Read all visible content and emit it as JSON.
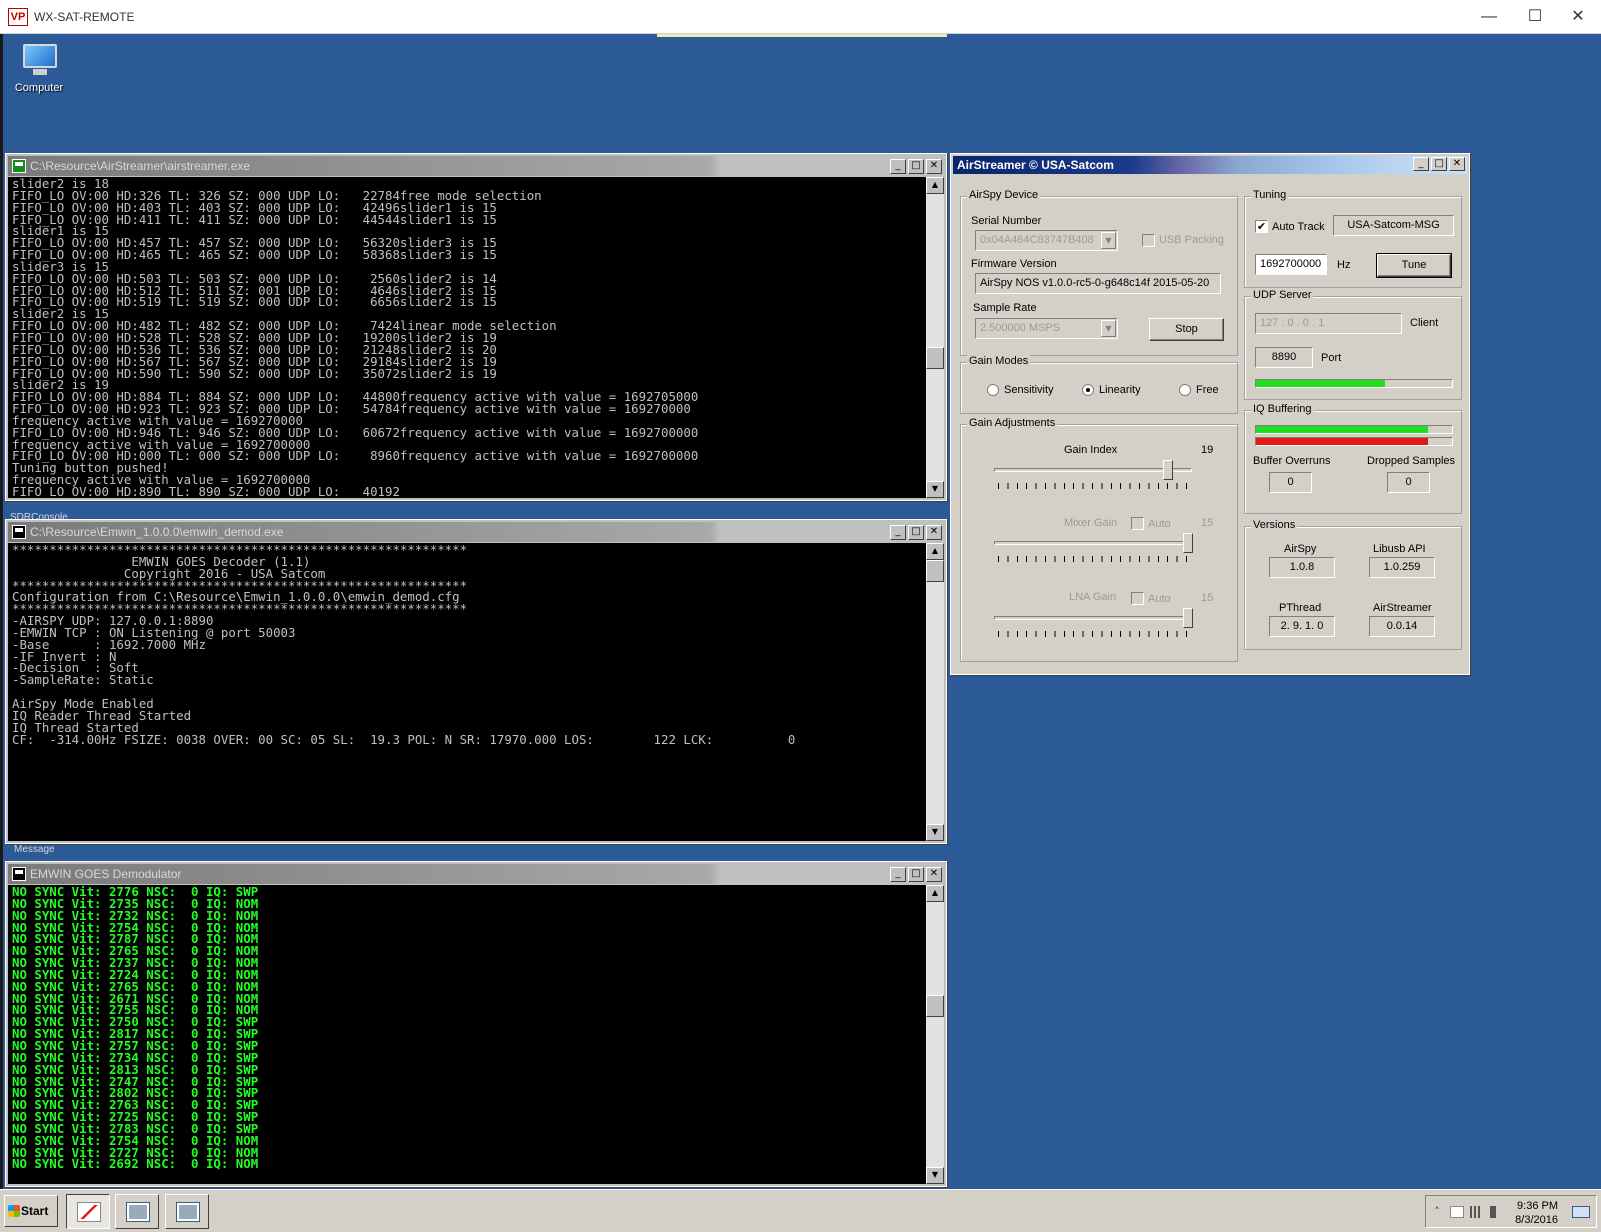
{
  "remote": {
    "title": "WX-SAT-REMOTE",
    "logo_text": "VP",
    "minimize": "—",
    "maximize": "☐",
    "close": "✕"
  },
  "desktop": {
    "computer_label": "Computer",
    "sdr_ghost": "SDRConsole",
    "message_ghost": "Message"
  },
  "airstreamer_console": {
    "title": "C:\\Resource\\AirStreamer\\airstreamer.exe",
    "lines": [
      "slider2 is 18",
      "FIFO_LO OV:00 HD:326 TL: 326 SZ: 000 UDP LO:   22784free mode selection",
      "FIFO_LO OV:00 HD:403 TL: 403 SZ: 000 UDP LO:   42496slider1 is 15",
      "FIFO_LO OV:00 HD:411 TL: 411 SZ: 000 UDP LO:   44544slider1 is 15",
      "slider1 is 15",
      "FIFO_LO OV:00 HD:457 TL: 457 SZ: 000 UDP LO:   56320slider3 is 15",
      "FIFO_LO OV:00 HD:465 TL: 465 SZ: 000 UDP LO:   58368slider3 is 15",
      "slider3 is 15",
      "FIFO_LO OV:00 HD:503 TL: 503 SZ: 000 UDP LO:    2560slider2 is 14",
      "FIFO_LO OV:00 HD:512 TL: 511 SZ: 001 UDP LO:    4646slider2 is 15",
      "FIFO_LO OV:00 HD:519 TL: 519 SZ: 000 UDP LO:    6656slider2 is 15",
      "slider2 is 15",
      "FIFO_LO OV:00 HD:482 TL: 482 SZ: 000 UDP LO:    7424linear mode selection",
      "FIFO_LO OV:00 HD:528 TL: 528 SZ: 000 UDP LO:   19200slider2 is 19",
      "FIFO_LO OV:00 HD:536 TL: 536 SZ: 000 UDP LO:   21248slider2 is 20",
      "FIFO_LO OV:00 HD:567 TL: 567 SZ: 000 UDP LO:   29184slider2 is 19",
      "FIFO_LO OV:00 HD:590 TL: 590 SZ: 000 UDP LO:   35072slider2 is 19",
      "slider2 is 19",
      "FIFO_LO OV:00 HD:884 TL: 884 SZ: 000 UDP LO:   44800frequency active with value = 1692705000",
      "FIFO_LO OV:00 HD:923 TL: 923 SZ: 000 UDP LO:   54784frequency active with value = 169270000",
      "frequency active with value = 169270000",
      "FIFO_LO OV:00 HD:946 TL: 946 SZ: 000 UDP LO:   60672frequency active with value = 1692700000",
      "frequency active with value = 1692700000",
      "FIFO_LO OV:00 HD:000 TL: 000 SZ: 000 UDP LO:    8960frequency active with value = 1692700000",
      "Tuning button pushed!",
      "frequency active with value = 1692700000",
      "FIFO_LO OV:00 HD:890 TL: 890 SZ: 000 UDP LO:   40192"
    ]
  },
  "emwin_console": {
    "title": "C:\\Resource\\Emwin_1.0.0.0\\emwin_demod.exe",
    "lines": [
      "*************************************************************",
      "                EMWIN GOES Decoder (1.1)",
      "               Copyright 2016 - USA Satcom",
      "*************************************************************",
      "Configuration from C:\\Resource\\Emwin_1.0.0.0\\emwin_demod.cfg",
      "*************************************************************",
      "-AIRSPY UDP: 127.0.0.1:8890",
      "-EMWIN TCP : ON Listening @ port 50003",
      "-Base      : 1692.7000 MHz",
      "-IF Invert : N",
      "-Decision  : Soft",
      "-SampleRate: Static",
      "",
      "AirSpy Mode Enabled",
      "IQ Reader Thread Started",
      "IQ Thread Started",
      "CF:  -314.00Hz FSIZE: 0038 OVER: 00 SC: 05 SL:  19.3 POL: N SR: 17970.000 LOS:        122 LCK:          0"
    ]
  },
  "demod_console": {
    "title": "EMWIN GOES Demodulator",
    "lines": [
      "NO SYNC Vit: 2776 NSC:  0 IQ: SWP",
      "NO SYNC Vit: 2735 NSC:  0 IQ: NOM",
      "NO SYNC Vit: 2732 NSC:  0 IQ: NOM",
      "NO SYNC Vit: 2754 NSC:  0 IQ: NOM",
      "NO SYNC Vit: 2787 NSC:  0 IQ: NOM",
      "NO SYNC Vit: 2765 NSC:  0 IQ: NOM",
      "NO SYNC Vit: 2737 NSC:  0 IQ: NOM",
      "NO SYNC Vit: 2724 NSC:  0 IQ: NOM",
      "NO SYNC Vit: 2765 NSC:  0 IQ: NOM",
      "NO SYNC Vit: 2671 NSC:  0 IQ: NOM",
      "NO SYNC Vit: 2755 NSC:  0 IQ: NOM",
      "NO SYNC Vit: 2750 NSC:  0 IQ: SWP",
      "NO SYNC Vit: 2817 NSC:  0 IQ: SWP",
      "NO SYNC Vit: 2757 NSC:  0 IQ: SWP",
      "NO SYNC Vit: 2734 NSC:  0 IQ: SWP",
      "NO SYNC Vit: 2813 NSC:  0 IQ: SWP",
      "NO SYNC Vit: 2747 NSC:  0 IQ: SWP",
      "NO SYNC Vit: 2802 NSC:  0 IQ: SWP",
      "NO SYNC Vit: 2763 NSC:  0 IQ: SWP",
      "NO SYNC Vit: 2725 NSC:  0 IQ: SWP",
      "NO SYNC Vit: 2783 NSC:  0 IQ: SWP",
      "NO SYNC Vit: 2754 NSC:  0 IQ: NOM",
      "NO SYNC Vit: 2727 NSC:  0 IQ: NOM",
      "NO SYNC Vit: 2692 NSC:  0 IQ: NOM"
    ]
  },
  "window_buttons": {
    "minimize": "_",
    "maximize": "□",
    "close": "✕",
    "scroll_up": "▲",
    "scroll_down": "▼"
  },
  "airstreamer": {
    "title": "AirStreamer © USA-Satcom",
    "device": {
      "legend": "AirSpy Device",
      "serial_label": "Serial Number",
      "serial_value": "0x04A464C83747B408",
      "usb_packing_label": "USB Packing",
      "firmware_label": "Firmware Version",
      "firmware_value": "AirSpy NOS v1.0.0-rc5-0-g648c14f 2015-05-20",
      "sample_rate_label": "Sample Rate",
      "sample_rate_value": "2.500000 MSPS",
      "stop_label": "Stop",
      "dropdown_arrow": "▼"
    },
    "tuning": {
      "legend": "Tuning",
      "auto_track_label": "Auto Track",
      "auto_track_checked": "✔",
      "track_name": "USA-Satcom-MSG",
      "frequency": "1692700000",
      "hz_label": "Hz",
      "tune_label": "Tune"
    },
    "udp": {
      "legend": "UDP Server",
      "ip": "127 .  0  .  0  .  1",
      "client_label": "Client",
      "port_value": "8890",
      "port_label": "Port",
      "level": 0.66,
      "color": "#22dd22"
    },
    "gain_modes": {
      "legend": "Gain Modes",
      "sensitivity": "Sensitivity",
      "linearity": "Linearity",
      "free": "Free",
      "selected": "linearity"
    },
    "gain_adj": {
      "legend": "Gain Adjustments",
      "gain_index_label": "Gain Index",
      "gain_index_value": "19",
      "gain_index_level": 0.88,
      "mixer_label": "Mixer Gain",
      "mixer_auto": "Auto",
      "mixer_value": "15",
      "mixer_level": 0.98,
      "lna_label": "LNA Gain",
      "lna_auto": "Auto",
      "lna_value": "15",
      "lna_level": 0.98
    },
    "iq": {
      "legend": "IQ Buffering",
      "green_level": 0.88,
      "red_level": 0.88,
      "green_color": "#22dd22",
      "red_color": "#e01818",
      "buffer_overruns_label": "Buffer Overruns",
      "buffer_overruns_value": "0",
      "dropped_label": "Dropped Samples",
      "dropped_value": "0"
    },
    "versions": {
      "legend": "Versions",
      "airspy_label": "AirSpy",
      "airspy_value": "1.0.8",
      "libusb_label": "Libusb API",
      "libusb_value": "1.0.259",
      "pthread_label": "PThread",
      "pthread_value": "2. 9. 1. 0",
      "airstreamer_label": "AirStreamer",
      "airstreamer_value": "0.0.14"
    }
  },
  "taskbar": {
    "start_label": "Start",
    "up_arrow": "˄",
    "time": "9:36 PM",
    "date": "8/3/2016"
  }
}
